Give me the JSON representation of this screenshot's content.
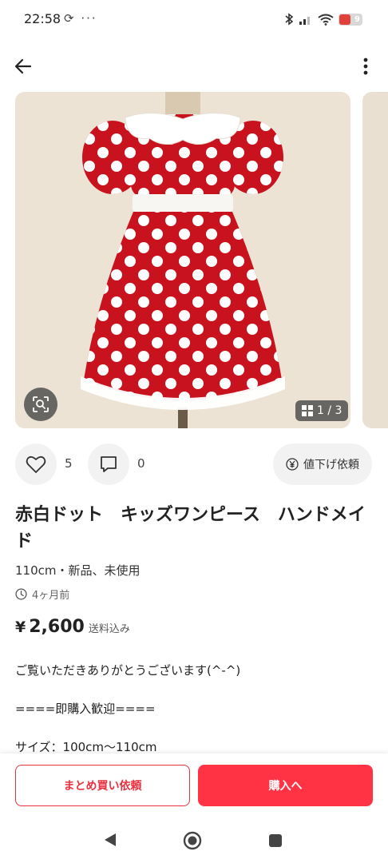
{
  "status_bar": {
    "time": "22:58",
    "left_icons": "⟳ ···",
    "battery_level": "9",
    "battery_color": "#e0413a"
  },
  "carousel": {
    "page_indicator": "1 / 3"
  },
  "actions": {
    "like_count": "5",
    "comment_count": "0",
    "price_down_label": "値下げ依頼"
  },
  "product": {
    "title": "赤白ドット　キッズワンピース　ハンドメイド",
    "size_condition": "110cm・新品、未使用",
    "posted": "4ヶ月前",
    "currency": "¥",
    "price": "2,600",
    "shipping": "送料込み"
  },
  "description": {
    "line1": "ご覧いただきありがとうございます(^-^)",
    "line2": "====即購入歓迎====",
    "line3": "サイズ：100cm〜110cm"
  },
  "bottom_bar": {
    "bundle_label": "まとめ買い依頼",
    "buy_label": "購入へ"
  },
  "colors": {
    "accent": "#ff3344",
    "accent_border": "#e8323f"
  }
}
